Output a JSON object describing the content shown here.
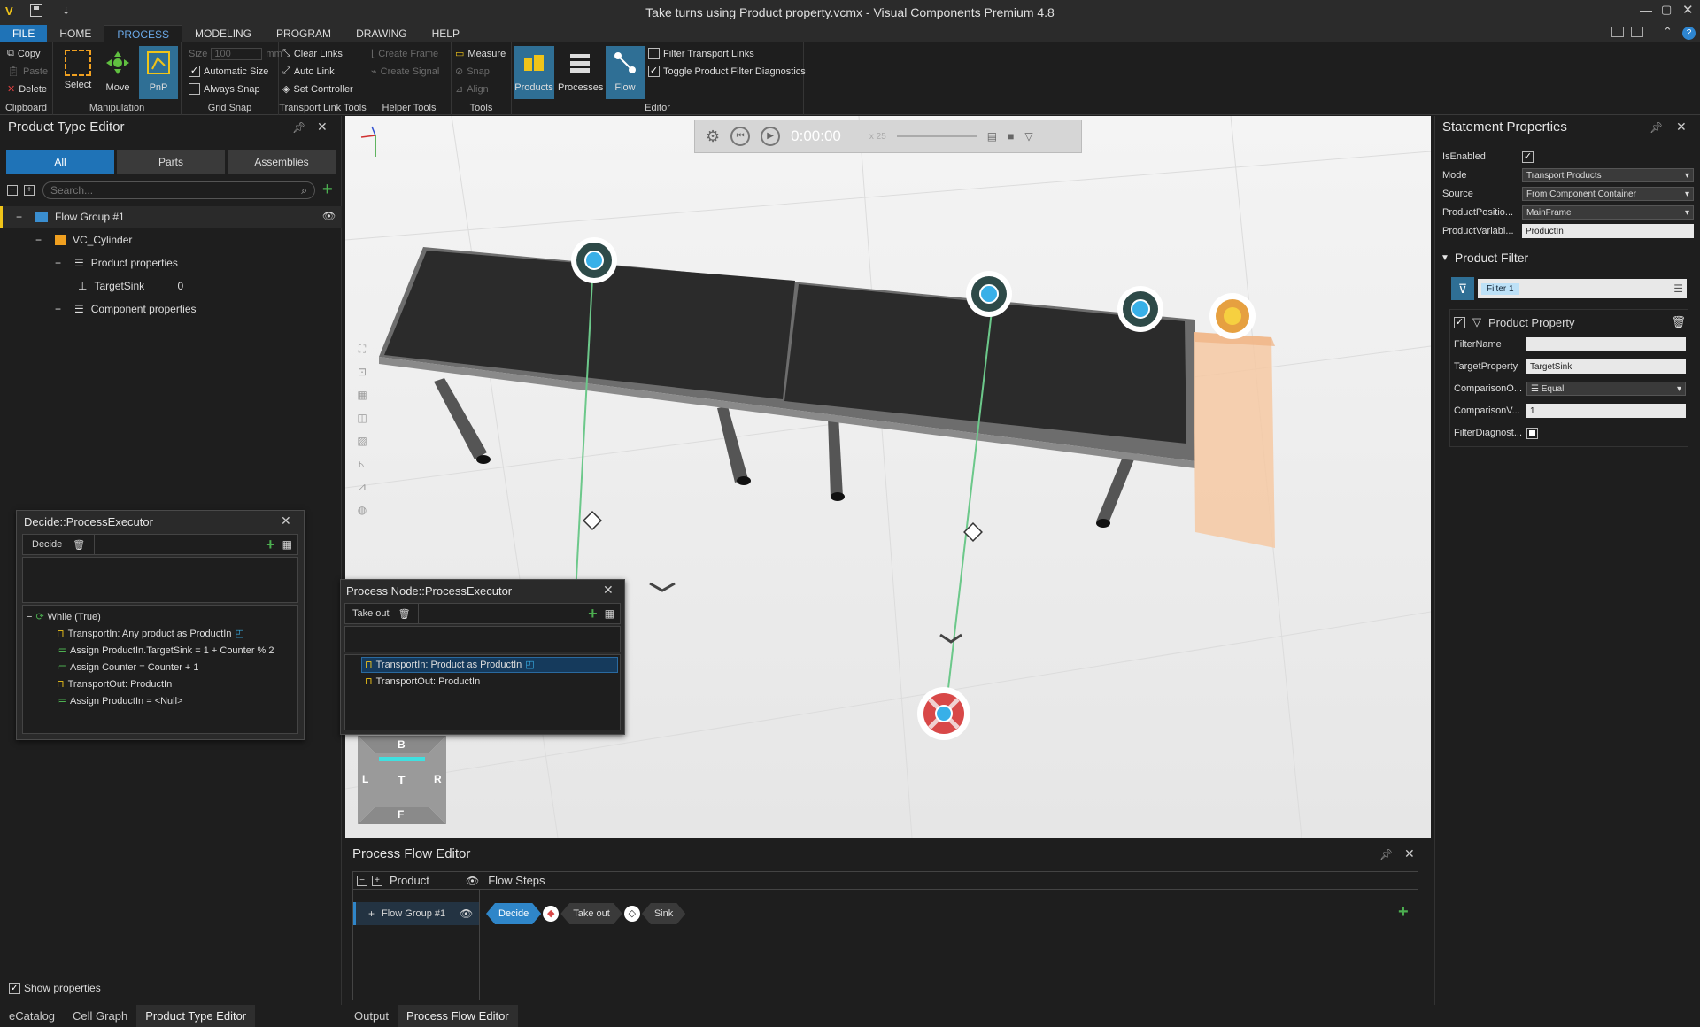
{
  "window": {
    "title": "Take turns using Product property.vcmx - Visual Components Premium 4.8"
  },
  "menu": [
    "FILE",
    "HOME",
    "PROCESS",
    "MODELING",
    "PROGRAM",
    "DRAWING",
    "HELP"
  ],
  "ribbon": {
    "clipboard": {
      "label": "Clipboard",
      "copy": "Copy",
      "paste": "Paste",
      "delete": "Delete"
    },
    "manipulation": {
      "label": "Manipulation",
      "select": "Select",
      "move": "Move",
      "pnp": "PnP"
    },
    "gridsnap": {
      "label": "Grid Snap",
      "size": "Size",
      "size_value": "100",
      "size_unit": "mm",
      "automatic_size": "Automatic Size",
      "always_snap": "Always Snap"
    },
    "transportlink": {
      "label": "Transport Link Tools",
      "clear": "Clear Links",
      "auto": "Auto Link",
      "set": "Set Controller"
    },
    "helper": {
      "label": "Helper Tools",
      "frame": "Create Frame",
      "signal": "Create Signal"
    },
    "tools": {
      "label": "Tools",
      "measure": "Measure",
      "snap": "Snap",
      "align": "Align"
    },
    "editor": {
      "label": "Editor",
      "products": "Products",
      "processes": "Processes",
      "flow": "Flow",
      "filter_links": "Filter Transport Links",
      "toggle_diag": "Toggle Product Filter Diagnostics"
    }
  },
  "product_type_editor": {
    "title": "Product Type Editor",
    "tabs": [
      "All",
      "Parts",
      "Assemblies"
    ],
    "search_placeholder": "Search...",
    "tree": {
      "group": "Flow Group #1",
      "cylinder": "VC_Cylinder",
      "product_props": "Product properties",
      "target": "TargetSink",
      "target_value": "0",
      "component_props": "Component properties"
    },
    "show_properties": "Show properties"
  },
  "decide": {
    "title": "Decide::ProcessExecutor",
    "tab": "Decide",
    "statements": [
      "While (True)",
      "TransportIn: Any product as ProductIn",
      "Assign ProductIn.TargetSink = 1 + Counter % 2",
      "Assign Counter = Counter + 1",
      "TransportOut: ProductIn",
      "Assign ProductIn = <Null>"
    ]
  },
  "process_node": {
    "title": "Process Node::ProcessExecutor",
    "tab": "Take out",
    "statements": [
      "TransportIn: Product as ProductIn",
      "TransportOut: ProductIn"
    ]
  },
  "sim": {
    "time": "0:00:00",
    "speed": "x 25"
  },
  "navcube": {
    "top": "B",
    "left": "L",
    "center": "T",
    "right": "R",
    "bottom": "F"
  },
  "statement_properties": {
    "title": "Statement Properties",
    "rows": [
      {
        "label": "IsEnabled",
        "value": ""
      },
      {
        "label": "Mode",
        "value": "Transport Products"
      },
      {
        "label": "Source",
        "value": "From Component Container"
      },
      {
        "label": "ProductPositio...",
        "value": "MainFrame"
      },
      {
        "label": "ProductVariabl...",
        "value": "ProductIn"
      }
    ],
    "filter_title": "Product Filter",
    "filter_name": "Filter 1",
    "product_property": "Product Property",
    "filter_rows": [
      {
        "label": "FilterName",
        "value": ""
      },
      {
        "label": "TargetProperty",
        "value": "TargetSink"
      },
      {
        "label": "ComparisonO...",
        "value": "Equal"
      },
      {
        "label": "ComparisonV...",
        "value": "1"
      },
      {
        "label": "FilterDiagnost...",
        "value": ""
      }
    ]
  },
  "process_flow_editor": {
    "title": "Process Flow Editor",
    "col_product": "Product",
    "col_steps": "Flow Steps",
    "group": "Flow Group #1",
    "steps": [
      "Decide",
      "Take out",
      "Sink"
    ]
  },
  "bottom_tabs_left": [
    "eCatalog",
    "Cell Graph",
    "Product Type Editor"
  ],
  "bottom_tabs_mid": [
    "Output",
    "Process Flow Editor"
  ]
}
